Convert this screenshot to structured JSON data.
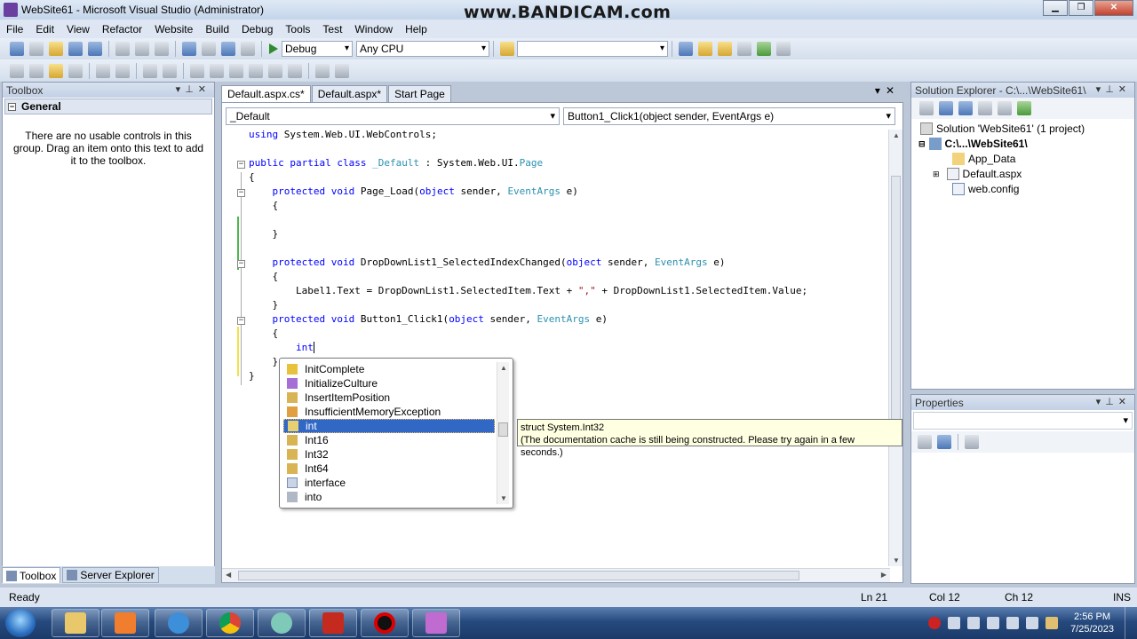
{
  "window": {
    "title": "WebSite61 - Microsoft Visual Studio (Administrator)",
    "watermark": "www.BANDICAM.com"
  },
  "menu": [
    "File",
    "Edit",
    "View",
    "Refactor",
    "Website",
    "Build",
    "Debug",
    "Tools",
    "Test",
    "Window",
    "Help"
  ],
  "toolbar": {
    "config": "Debug",
    "platform": "Any CPU"
  },
  "toolbox": {
    "title": "Toolbox",
    "group": "General",
    "empty_msg": "There are no usable controls in this group. Drag an item onto this text to add it to the toolbox.",
    "tabs": [
      "Toolbox",
      "Server Explorer"
    ]
  },
  "editor": {
    "tabs": [
      "Default.aspx.cs*",
      "Default.aspx*",
      "Start Page"
    ],
    "type_combo": "_Default",
    "member_combo": "Button1_Click1(object sender, EventArgs e)"
  },
  "code": [
    "using System.Web.UI.WebControls;",
    "public partial class _Default : System.Web.UI.Page",
    "{",
    "protected void Page_Load(object sender, EventArgs e)",
    "{",
    "}",
    "protected void DropDownList1_SelectedIndexChanged(object sender, EventArgs e)",
    "{",
    "Label1.Text = DropDownList1.SelectedItem.Text + \",\" + DropDownList1.SelectedItem.Value;",
    "}",
    "protected void Button1_Click1(object sender, EventArgs e)",
    "{",
    "int",
    "}",
    "}"
  ],
  "intellisense": {
    "items": [
      "InitComplete",
      "InitializeCulture",
      "InsertItemPosition",
      "InsufficientMemoryException",
      "int",
      "Int16",
      "Int32",
      "Int64",
      "interface",
      "into"
    ],
    "selected_index": 4,
    "tooltip_line1": "struct System.Int32",
    "tooltip_line2": "(The documentation cache is still being constructed. Please try again in a few seconds.)"
  },
  "solution_explorer": {
    "title": "Solution Explorer - C:\\...\\WebSite61\\",
    "solution": "Solution 'WebSite61' (1 project)",
    "project": "C:\\...\\WebSite61\\",
    "items": [
      "App_Data",
      "Default.aspx",
      "web.config"
    ]
  },
  "properties": {
    "title": "Properties"
  },
  "status": {
    "text": "Ready",
    "ln": "Ln 21",
    "col": "Col 12",
    "ch": "Ch 12",
    "mode": "INS"
  },
  "clock": {
    "time": "2:56 PM",
    "date": "7/25/2023"
  }
}
